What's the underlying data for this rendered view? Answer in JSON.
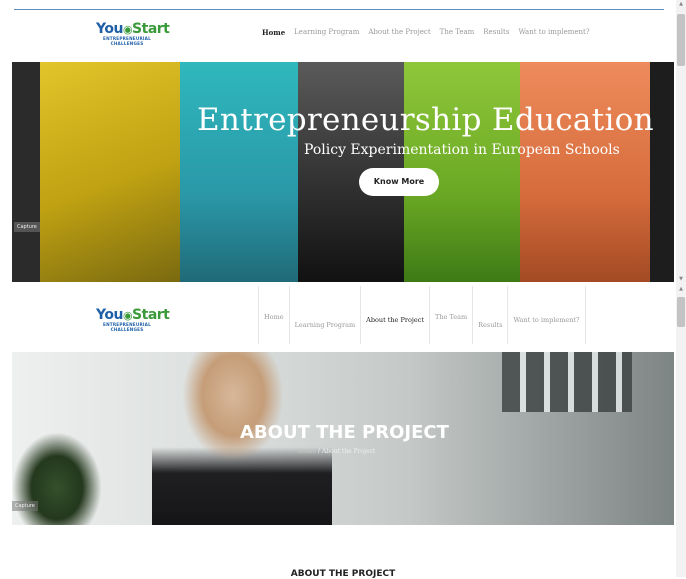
{
  "logo": {
    "you": "You",
    "start": "Start",
    "sub1": "ENTREPRENEURIAL",
    "sub2": "CHALLENGES"
  },
  "nav": {
    "home": "Home",
    "learning": "Learning Program",
    "about": "About the Project",
    "team": "The Team",
    "results": "Results",
    "implement": "Want to implement?"
  },
  "hero": {
    "title": "Entrepreneurship Education",
    "subtitle": "Policy Experimentation in European Schools",
    "button": "Know More",
    "caption": "Capture",
    "colors": [
      "#c9a914",
      "#35b9b7",
      "#3c3c3c",
      "#7bbd2a",
      "#e47848"
    ]
  },
  "banner": {
    "title": "ABOUT THE PROJECT",
    "crumb_home": "Home",
    "crumb_sep": " / ",
    "crumb_current": "About the Project",
    "caption": "Capture"
  },
  "section": {
    "title": "ABOUT THE PROJECT"
  },
  "scrollbar": {
    "up": "▲",
    "down": "▼"
  }
}
